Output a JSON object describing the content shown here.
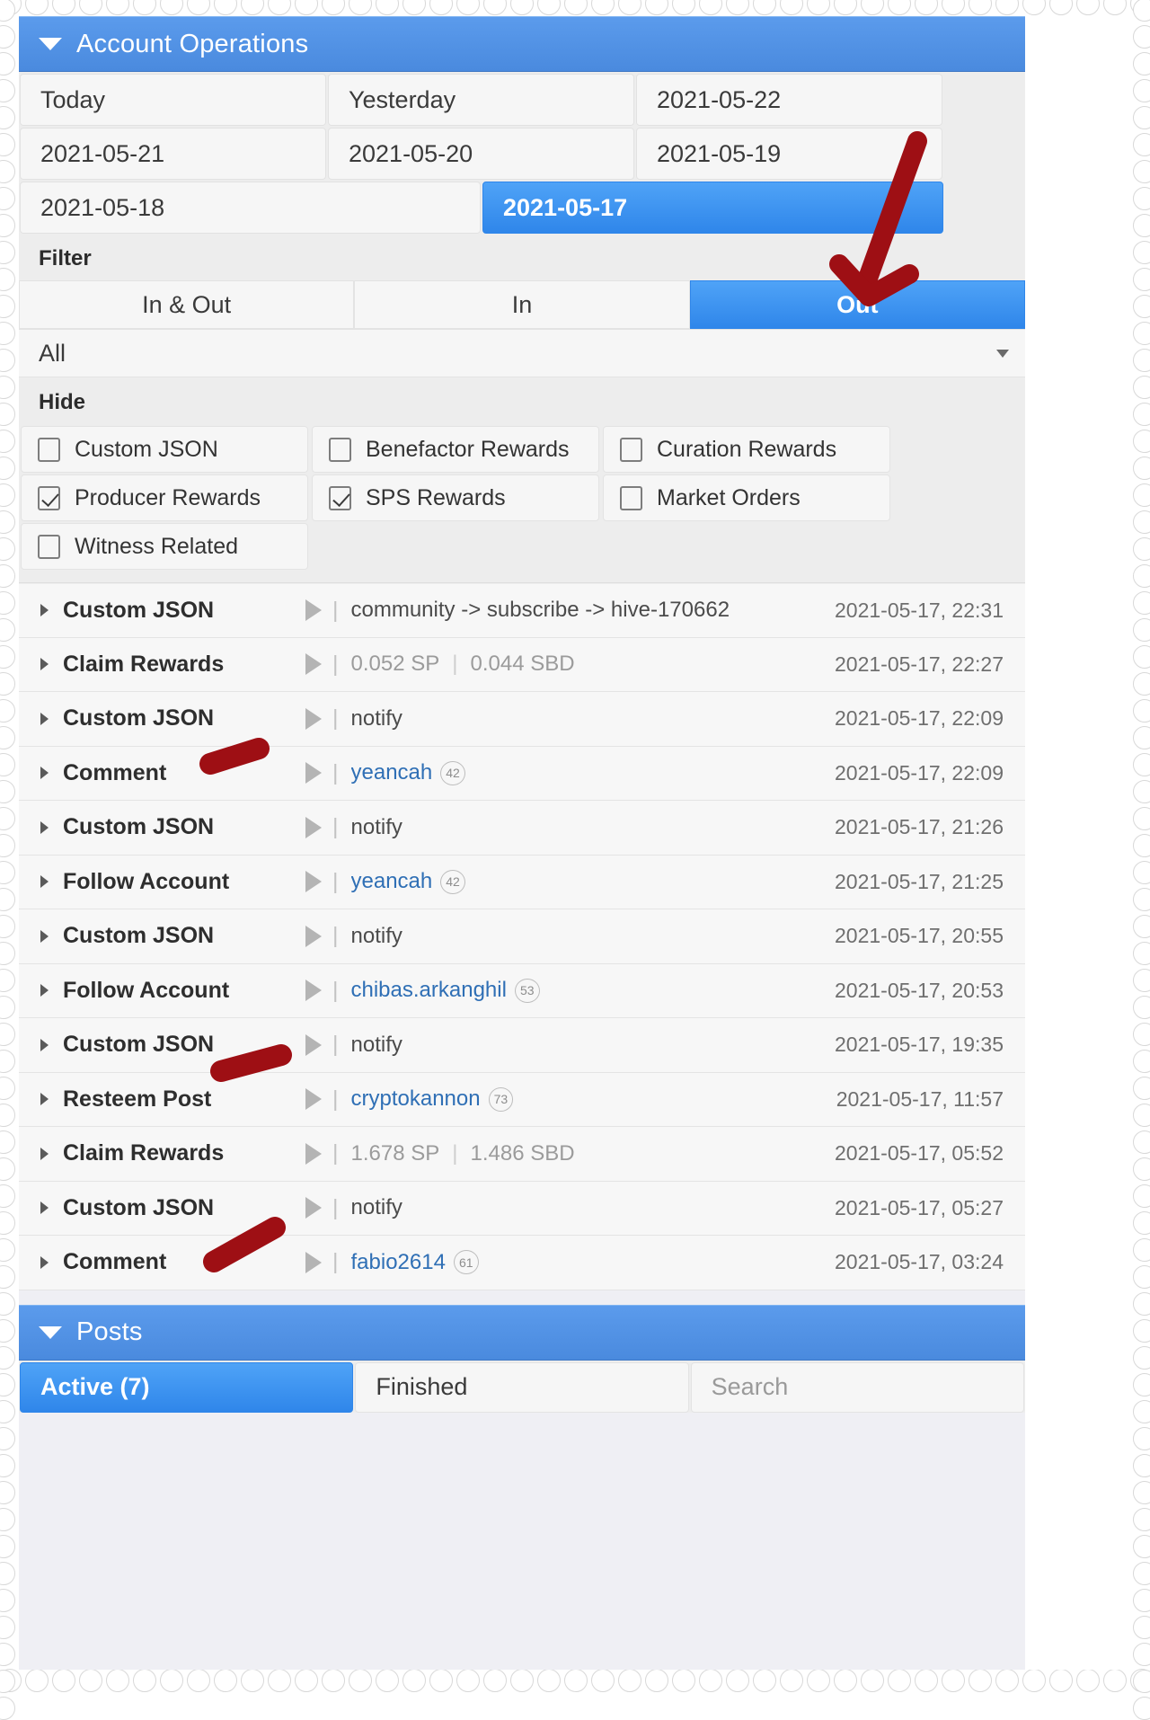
{
  "section": {
    "title": "Account Operations",
    "collapse_icon": "caret-down-icon"
  },
  "date_buttons": [
    {
      "label": "Today",
      "selected": false
    },
    {
      "label": "Yesterday",
      "selected": false
    },
    {
      "label": "2021-05-22",
      "selected": false
    },
    {
      "label": "2021-05-21",
      "selected": false
    },
    {
      "label": "2021-05-20",
      "selected": false
    },
    {
      "label": "2021-05-19",
      "selected": false
    },
    {
      "label": "2021-05-18",
      "selected": false
    },
    {
      "label": "2021-05-17",
      "selected": true
    }
  ],
  "filter": {
    "label": "Filter",
    "segments": [
      {
        "label": "In & Out",
        "selected": false
      },
      {
        "label": "In",
        "selected": false
      },
      {
        "label": "Out",
        "selected": true
      }
    ],
    "select_value": "All",
    "select_icon": "chevron-down-icon"
  },
  "hide": {
    "label": "Hide",
    "options": [
      {
        "label": "Custom JSON",
        "checked": false
      },
      {
        "label": "Benefactor Rewards",
        "checked": false
      },
      {
        "label": "Curation Rewards",
        "checked": false
      },
      {
        "label": "Producer Rewards",
        "checked": true
      },
      {
        "label": "SPS Rewards",
        "checked": true
      },
      {
        "label": "Market Orders",
        "checked": false
      },
      {
        "label": "Witness Related",
        "checked": false
      }
    ]
  },
  "operations": [
    {
      "type": "Custom JSON",
      "detail": "community -> subscribe -> hive-170662",
      "muted": false,
      "user": "",
      "rep": "",
      "amounts": [],
      "time": "2021-05-17, 22:31"
    },
    {
      "type": "Claim Rewards",
      "detail": "",
      "muted": true,
      "user": "",
      "rep": "",
      "amounts": [
        "0.052 SP",
        "0.044 SBD"
      ],
      "time": "2021-05-17, 22:27"
    },
    {
      "type": "Custom JSON",
      "detail": "notify",
      "muted": false,
      "user": "",
      "rep": "",
      "amounts": [],
      "time": "2021-05-17, 22:09"
    },
    {
      "type": "Comment",
      "detail": "",
      "muted": false,
      "user": "yeancah",
      "rep": "42",
      "amounts": [],
      "time": "2021-05-17, 22:09"
    },
    {
      "type": "Custom JSON",
      "detail": "notify",
      "muted": false,
      "user": "",
      "rep": "",
      "amounts": [],
      "time": "2021-05-17, 21:26"
    },
    {
      "type": "Follow Account",
      "detail": "",
      "muted": false,
      "user": "yeancah",
      "rep": "42",
      "amounts": [],
      "time": "2021-05-17, 21:25"
    },
    {
      "type": "Custom JSON",
      "detail": "notify",
      "muted": false,
      "user": "",
      "rep": "",
      "amounts": [],
      "time": "2021-05-17, 20:55"
    },
    {
      "type": "Follow Account",
      "detail": "",
      "muted": false,
      "user": "chibas.arkanghil",
      "rep": "53",
      "amounts": [],
      "time": "2021-05-17, 20:53"
    },
    {
      "type": "Custom JSON",
      "detail": "notify",
      "muted": false,
      "user": "",
      "rep": "",
      "amounts": [],
      "time": "2021-05-17, 19:35"
    },
    {
      "type": "Resteem Post",
      "detail": "",
      "muted": false,
      "user": "cryptokannon",
      "rep": "73",
      "amounts": [],
      "time": "2021-05-17, 11:57"
    },
    {
      "type": "Claim Rewards",
      "detail": "",
      "muted": true,
      "user": "",
      "rep": "",
      "amounts": [
        "1.678 SP",
        "1.486 SBD"
      ],
      "time": "2021-05-17, 05:52"
    },
    {
      "type": "Custom JSON",
      "detail": "notify",
      "muted": false,
      "user": "",
      "rep": "",
      "amounts": [],
      "time": "2021-05-17, 05:27"
    },
    {
      "type": "Comment",
      "detail": "",
      "muted": false,
      "user": "fabio2614",
      "rep": "61",
      "amounts": [],
      "time": "2021-05-17, 03:24"
    }
  ],
  "posts": {
    "title": "Posts",
    "collapse_icon": "caret-down-icon",
    "tabs": [
      {
        "label": "Active (7)",
        "selected": true
      },
      {
        "label": "Finished",
        "selected": false
      },
      {
        "label": "Search",
        "selected": false
      }
    ]
  },
  "annotations": {
    "color": "#9e0f14",
    "marks": [
      {
        "kind": "arrow",
        "target": "out-segment-button"
      },
      {
        "kind": "underline",
        "target": "comment-row-yeancah"
      },
      {
        "kind": "underline",
        "target": "resteem-post-row"
      },
      {
        "kind": "underline",
        "target": "comment-row-fabio2614"
      }
    ]
  }
}
